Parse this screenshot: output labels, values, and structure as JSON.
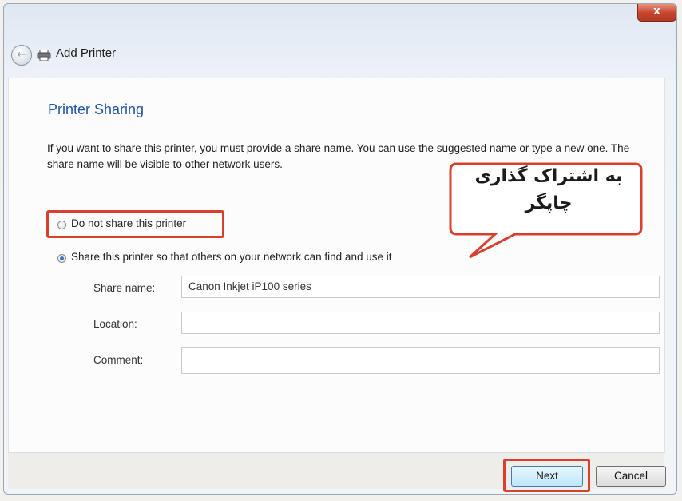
{
  "window": {
    "title": "Add Printer",
    "close_glyph": "x"
  },
  "page": {
    "heading": "Printer Sharing",
    "description": "If you want to share this printer, you must provide a share name. You can use the suggested name or type a new one. The share name will be visible to other network users."
  },
  "options": {
    "do_not_share": {
      "label": "Do not share this printer",
      "selected": false
    },
    "share": {
      "label": "Share this printer so that others on your network can find and use it",
      "selected": true
    }
  },
  "fields": {
    "share_name": {
      "label": "Share name:",
      "value": "Canon Inkjet iP100 series"
    },
    "location": {
      "label": "Location:",
      "value": ""
    },
    "comment": {
      "label": "Comment:",
      "value": ""
    }
  },
  "buttons": {
    "next": "Next",
    "cancel": "Cancel"
  },
  "callout": {
    "text": "به اشتراک گذاری چاپگر"
  },
  "colors": {
    "highlight_border": "#d9402c",
    "heading": "#1f56a6",
    "radio_selected": "#3b76c9"
  },
  "icons": {
    "back": "back-arrow-icon",
    "printer": "printer-icon",
    "close": "close-icon"
  }
}
